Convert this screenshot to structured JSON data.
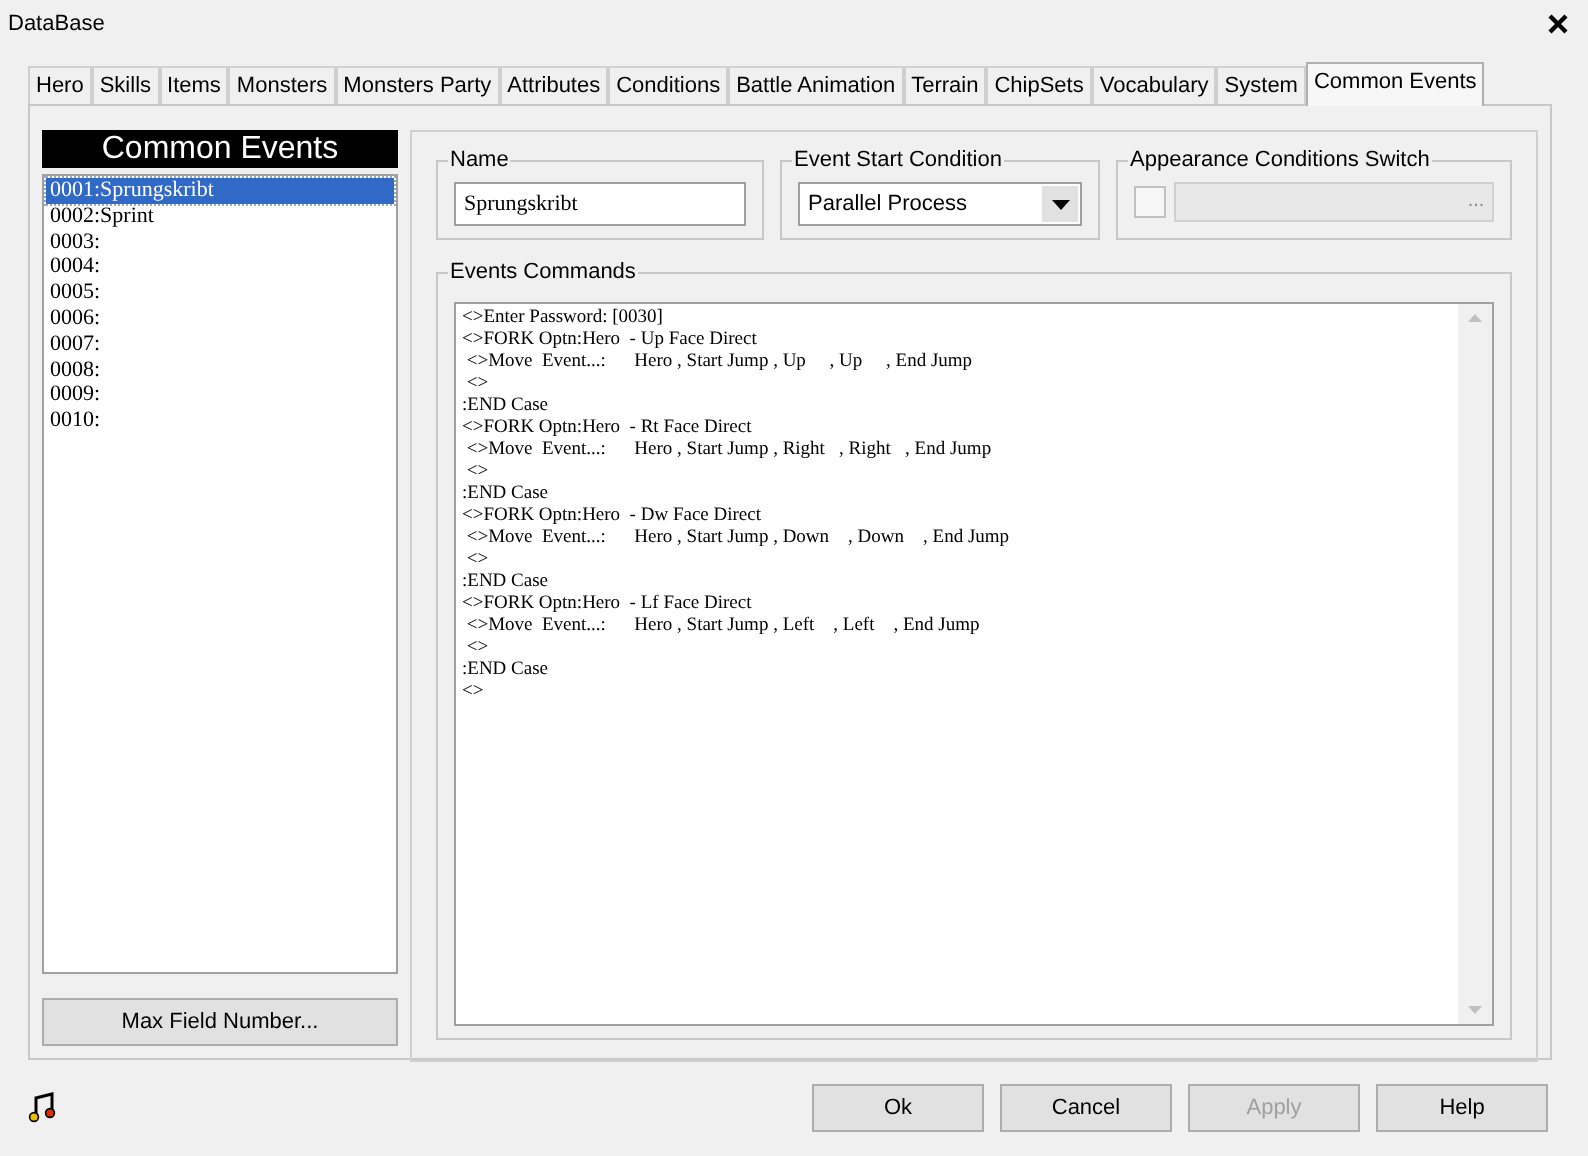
{
  "window": {
    "title": "DataBase"
  },
  "tabs": [
    {
      "label": "Hero",
      "selected": false
    },
    {
      "label": "Skills",
      "selected": false
    },
    {
      "label": "Items",
      "selected": false
    },
    {
      "label": "Monsters",
      "selected": false
    },
    {
      "label": "Monsters Party",
      "selected": false
    },
    {
      "label": "Attributes",
      "selected": false
    },
    {
      "label": "Conditions",
      "selected": false
    },
    {
      "label": "Battle Animation",
      "selected": false
    },
    {
      "label": "Terrain",
      "selected": false
    },
    {
      "label": "ChipSets",
      "selected": false
    },
    {
      "label": "Vocabulary",
      "selected": false
    },
    {
      "label": "System",
      "selected": false
    },
    {
      "label": "Common Events",
      "selected": true
    }
  ],
  "event_list": {
    "title": "Common Events",
    "items": [
      {
        "label": "0001:Sprungskribt",
        "selected": true
      },
      {
        "label": "0002:Sprint",
        "selected": false
      },
      {
        "label": "0003:",
        "selected": false
      },
      {
        "label": "0004:",
        "selected": false
      },
      {
        "label": "0005:",
        "selected": false
      },
      {
        "label": "0006:",
        "selected": false
      },
      {
        "label": "0007:",
        "selected": false
      },
      {
        "label": "0008:",
        "selected": false
      },
      {
        "label": "0009:",
        "selected": false
      },
      {
        "label": "0010:",
        "selected": false
      }
    ],
    "button": "Max Field Number..."
  },
  "name": {
    "label": "Name",
    "value": "Sprungskribt"
  },
  "start_condition": {
    "label": "Event Start Condition",
    "value": "Parallel Process"
  },
  "appearance_switch": {
    "label": "Appearance Conditions Switch",
    "checked": false,
    "button": "..."
  },
  "commands": {
    "label": "Events Commands",
    "lines": [
      "<>Enter Password: [0030]",
      "<>FORK Optn:Hero  - Up Face Direct",
      " <>Move  Event...:      Hero , Start Jump , Up     , Up     , End Jump",
      " <>",
      ":END Case",
      "<>FORK Optn:Hero  - Rt Face Direct",
      " <>Move  Event...:      Hero , Start Jump , Right   , Right   , End Jump",
      " <>",
      ":END Case",
      "<>FORK Optn:Hero  - Dw Face Direct",
      " <>Move  Event...:      Hero , Start Jump , Down    , Down    , End Jump",
      " <>",
      ":END Case",
      "<>FORK Optn:Hero  - Lf Face Direct",
      " <>Move  Event...:      Hero , Start Jump , Left    , Left    , End Jump",
      " <>",
      ":END Case",
      "<>"
    ]
  },
  "buttons": [
    {
      "label": "Ok",
      "disabled": false
    },
    {
      "label": "Cancel",
      "disabled": false
    },
    {
      "label": "Apply",
      "disabled": true
    },
    {
      "label": "Help",
      "disabled": false
    }
  ]
}
